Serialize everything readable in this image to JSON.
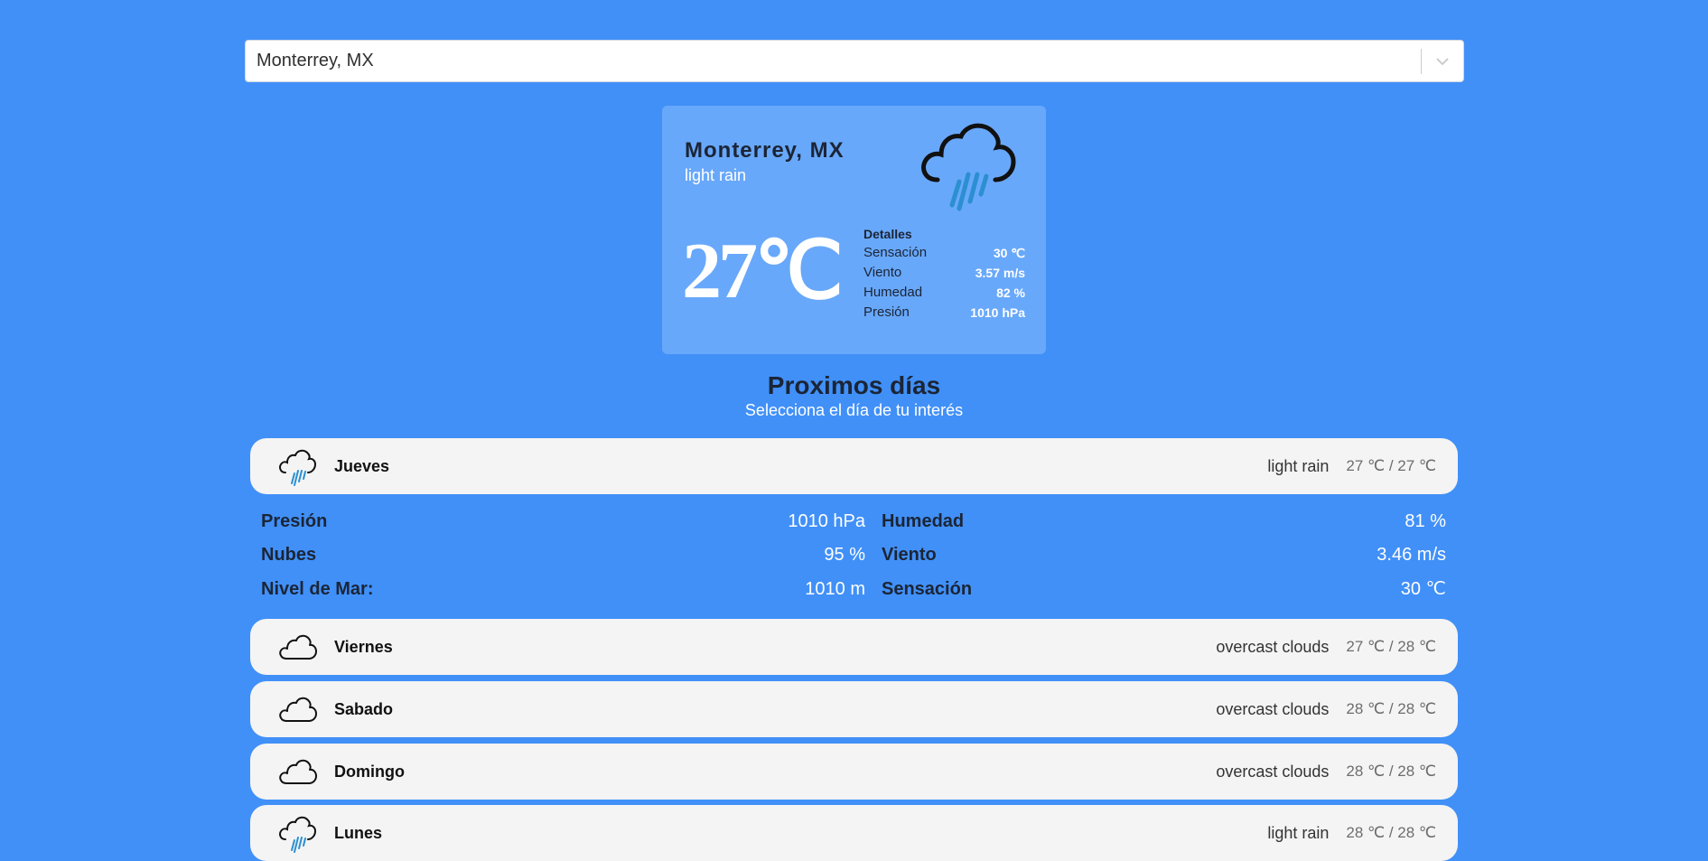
{
  "search": {
    "value": "Monterrey, MX"
  },
  "current": {
    "city": "Monterrey, MX",
    "description": "light rain",
    "temperature": "27℃",
    "icon": "rain-cloud-icon",
    "details_title": "Detalles",
    "details": [
      {
        "label": "Sensación",
        "value": "30 ℃"
      },
      {
        "label": "Viento",
        "value": "3.57 m/s"
      },
      {
        "label": "Humedad",
        "value": "82 %"
      },
      {
        "label": "Presión",
        "value": "1010 hPa"
      }
    ]
  },
  "forecast": {
    "title": "Proximos días",
    "subtitle": "Selecciona el día de tu interés",
    "days": [
      {
        "name": "Jueves",
        "description": "light rain",
        "temp": "27 ℃ / 27 ℃",
        "icon": "rain-cloud-icon"
      },
      {
        "name": "Viernes",
        "description": "overcast clouds",
        "temp": "27 ℃ / 28 ℃",
        "icon": "cloud-icon"
      },
      {
        "name": "Sabado",
        "description": "overcast clouds",
        "temp": "28 ℃ / 28 ℃",
        "icon": "cloud-icon"
      },
      {
        "name": "Domingo",
        "description": "overcast clouds",
        "temp": "28 ℃ / 28 ℃",
        "icon": "cloud-icon"
      },
      {
        "name": "Lunes",
        "description": "light rain",
        "temp": "28 ℃ / 28 ℃",
        "icon": "rain-cloud-icon"
      }
    ],
    "expanded_details": {
      "left": [
        {
          "label": "Presión",
          "value": "1010 hPa"
        },
        {
          "label": "Nubes",
          "value": "95 %"
        },
        {
          "label": "Nivel de Mar:",
          "value": "1010 m"
        }
      ],
      "right": [
        {
          "label": "Humedad",
          "value": "81 %"
        },
        {
          "label": "Viento",
          "value": "3.46 m/s"
        },
        {
          "label": "Sensación",
          "value": "30 ℃"
        }
      ]
    }
  },
  "colors": {
    "background": "#4190f8",
    "card": "#68a8fa",
    "item": "#f4f4f4",
    "rain_accent": "#2b8fd0"
  }
}
